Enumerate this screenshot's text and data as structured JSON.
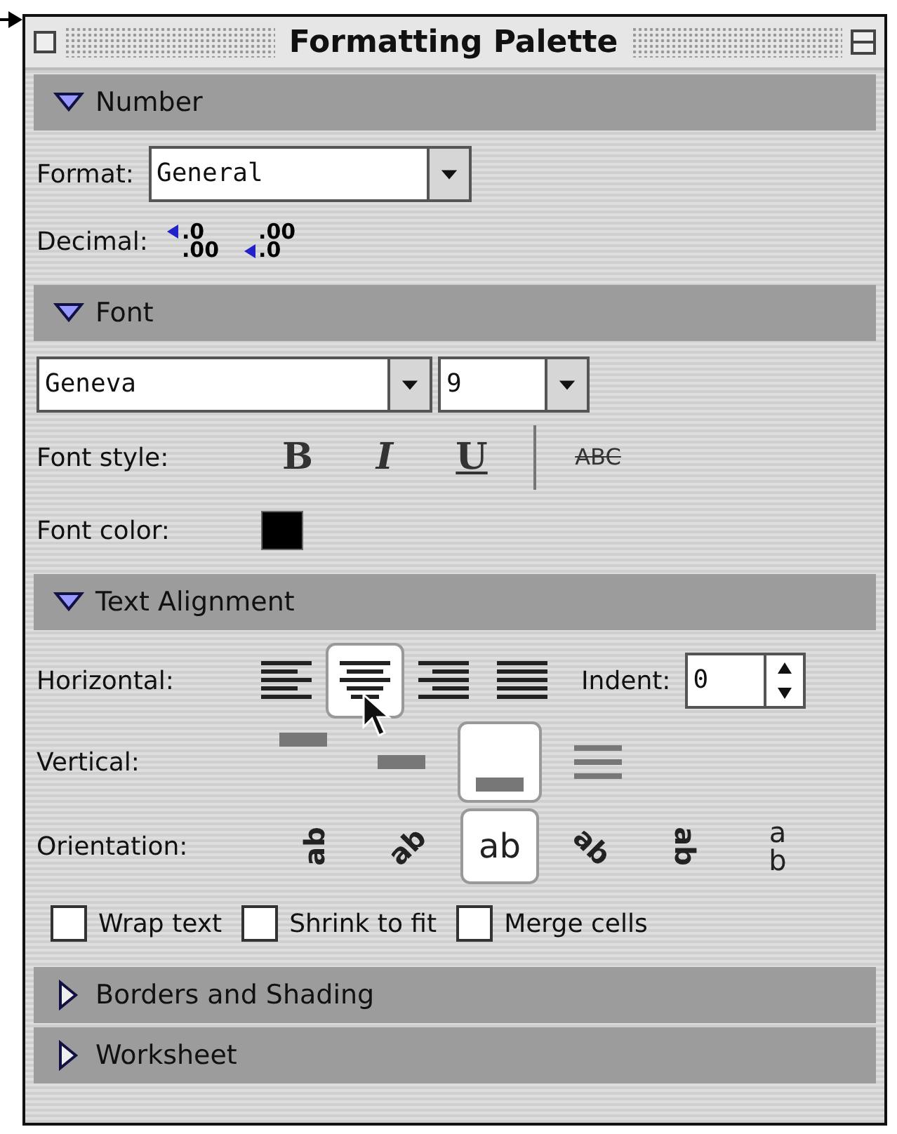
{
  "window": {
    "title": "Formatting Palette"
  },
  "sections": [
    {
      "kind": "number",
      "title": "Number",
      "expanded": true,
      "format_label": "Format:",
      "format_value": "General",
      "decimal_label": "Decimal:",
      "decimal_buttons": [
        {
          "kind": "increase",
          "top": ".0",
          "bottom": ".00"
        },
        {
          "kind": "decrease",
          "top": ".00",
          "bottom": ".0"
        }
      ]
    },
    {
      "kind": "font",
      "title": "Font",
      "expanded": true,
      "font_name": "Geneva",
      "font_size": "9",
      "style_label": "Font style:",
      "styles": [
        {
          "kind": "bold",
          "label": "B"
        },
        {
          "kind": "italic",
          "label": "I"
        },
        {
          "kind": "underline",
          "label": "U"
        },
        {
          "kind": "strikethrough",
          "label": "ABC"
        }
      ],
      "color_label": "Font color:",
      "font_color": {
        "color": "#000000"
      }
    },
    {
      "kind": "alignment",
      "title": "Text Alignment",
      "expanded": true,
      "horizontal_label": "Horizontal:",
      "horizontal": [
        {
          "kind": "left",
          "selected": false
        },
        {
          "kind": "center",
          "selected": true
        },
        {
          "kind": "right",
          "selected": false
        },
        {
          "kind": "justify",
          "selected": false
        }
      ],
      "indent_label": "Indent:",
      "indent_value": "0",
      "vertical_label": "Vertical:",
      "vertical": [
        {
          "kind": "top",
          "selected": false
        },
        {
          "kind": "center",
          "selected": false
        },
        {
          "kind": "bottom",
          "selected": true
        },
        {
          "kind": "justify",
          "selected": false
        }
      ],
      "orientation_label": "Orientation:",
      "orientation": [
        {
          "kind": "up",
          "label": "ab",
          "selected": false
        },
        {
          "kind": "diag-up",
          "label": "ab",
          "selected": false
        },
        {
          "kind": "horizontal",
          "label": "ab",
          "selected": true
        },
        {
          "kind": "diag-down",
          "label": "ab",
          "selected": false
        },
        {
          "kind": "down",
          "label": "ab",
          "selected": false
        },
        {
          "kind": "stacked",
          "label": "ab",
          "selected": false
        }
      ],
      "options": [
        {
          "label": "Wrap text",
          "checked": false
        },
        {
          "label": "Shrink to fit",
          "checked": false
        },
        {
          "label": "Merge cells",
          "checked": false
        }
      ]
    },
    {
      "title": "Borders and Shading",
      "expanded": false
    },
    {
      "title": "Worksheet",
      "expanded": false
    }
  ]
}
